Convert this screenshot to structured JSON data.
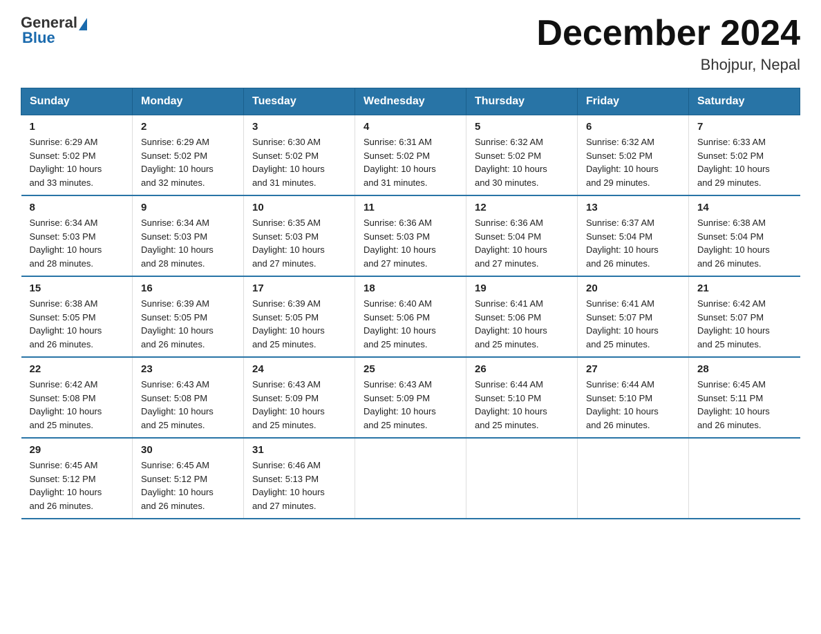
{
  "header": {
    "logo_general": "General",
    "logo_blue": "Blue",
    "month_title": "December 2024",
    "location": "Bhojpur, Nepal"
  },
  "days_of_week": [
    "Sunday",
    "Monday",
    "Tuesday",
    "Wednesday",
    "Thursday",
    "Friday",
    "Saturday"
  ],
  "weeks": [
    [
      {
        "day": "1",
        "sunrise": "6:29 AM",
        "sunset": "5:02 PM",
        "daylight": "10 hours and 33 minutes."
      },
      {
        "day": "2",
        "sunrise": "6:29 AM",
        "sunset": "5:02 PM",
        "daylight": "10 hours and 32 minutes."
      },
      {
        "day": "3",
        "sunrise": "6:30 AM",
        "sunset": "5:02 PM",
        "daylight": "10 hours and 31 minutes."
      },
      {
        "day": "4",
        "sunrise": "6:31 AM",
        "sunset": "5:02 PM",
        "daylight": "10 hours and 31 minutes."
      },
      {
        "day": "5",
        "sunrise": "6:32 AM",
        "sunset": "5:02 PM",
        "daylight": "10 hours and 30 minutes."
      },
      {
        "day": "6",
        "sunrise": "6:32 AM",
        "sunset": "5:02 PM",
        "daylight": "10 hours and 29 minutes."
      },
      {
        "day": "7",
        "sunrise": "6:33 AM",
        "sunset": "5:02 PM",
        "daylight": "10 hours and 29 minutes."
      }
    ],
    [
      {
        "day": "8",
        "sunrise": "6:34 AM",
        "sunset": "5:03 PM",
        "daylight": "10 hours and 28 minutes."
      },
      {
        "day": "9",
        "sunrise": "6:34 AM",
        "sunset": "5:03 PM",
        "daylight": "10 hours and 28 minutes."
      },
      {
        "day": "10",
        "sunrise": "6:35 AM",
        "sunset": "5:03 PM",
        "daylight": "10 hours and 27 minutes."
      },
      {
        "day": "11",
        "sunrise": "6:36 AM",
        "sunset": "5:03 PM",
        "daylight": "10 hours and 27 minutes."
      },
      {
        "day": "12",
        "sunrise": "6:36 AM",
        "sunset": "5:04 PM",
        "daylight": "10 hours and 27 minutes."
      },
      {
        "day": "13",
        "sunrise": "6:37 AM",
        "sunset": "5:04 PM",
        "daylight": "10 hours and 26 minutes."
      },
      {
        "day": "14",
        "sunrise": "6:38 AM",
        "sunset": "5:04 PM",
        "daylight": "10 hours and 26 minutes."
      }
    ],
    [
      {
        "day": "15",
        "sunrise": "6:38 AM",
        "sunset": "5:05 PM",
        "daylight": "10 hours and 26 minutes."
      },
      {
        "day": "16",
        "sunrise": "6:39 AM",
        "sunset": "5:05 PM",
        "daylight": "10 hours and 26 minutes."
      },
      {
        "day": "17",
        "sunrise": "6:39 AM",
        "sunset": "5:05 PM",
        "daylight": "10 hours and 25 minutes."
      },
      {
        "day": "18",
        "sunrise": "6:40 AM",
        "sunset": "5:06 PM",
        "daylight": "10 hours and 25 minutes."
      },
      {
        "day": "19",
        "sunrise": "6:41 AM",
        "sunset": "5:06 PM",
        "daylight": "10 hours and 25 minutes."
      },
      {
        "day": "20",
        "sunrise": "6:41 AM",
        "sunset": "5:07 PM",
        "daylight": "10 hours and 25 minutes."
      },
      {
        "day": "21",
        "sunrise": "6:42 AM",
        "sunset": "5:07 PM",
        "daylight": "10 hours and 25 minutes."
      }
    ],
    [
      {
        "day": "22",
        "sunrise": "6:42 AM",
        "sunset": "5:08 PM",
        "daylight": "10 hours and 25 minutes."
      },
      {
        "day": "23",
        "sunrise": "6:43 AM",
        "sunset": "5:08 PM",
        "daylight": "10 hours and 25 minutes."
      },
      {
        "day": "24",
        "sunrise": "6:43 AM",
        "sunset": "5:09 PM",
        "daylight": "10 hours and 25 minutes."
      },
      {
        "day": "25",
        "sunrise": "6:43 AM",
        "sunset": "5:09 PM",
        "daylight": "10 hours and 25 minutes."
      },
      {
        "day": "26",
        "sunrise": "6:44 AM",
        "sunset": "5:10 PM",
        "daylight": "10 hours and 25 minutes."
      },
      {
        "day": "27",
        "sunrise": "6:44 AM",
        "sunset": "5:10 PM",
        "daylight": "10 hours and 26 minutes."
      },
      {
        "day": "28",
        "sunrise": "6:45 AM",
        "sunset": "5:11 PM",
        "daylight": "10 hours and 26 minutes."
      }
    ],
    [
      {
        "day": "29",
        "sunrise": "6:45 AM",
        "sunset": "5:12 PM",
        "daylight": "10 hours and 26 minutes."
      },
      {
        "day": "30",
        "sunrise": "6:45 AM",
        "sunset": "5:12 PM",
        "daylight": "10 hours and 26 minutes."
      },
      {
        "day": "31",
        "sunrise": "6:46 AM",
        "sunset": "5:13 PM",
        "daylight": "10 hours and 27 minutes."
      },
      null,
      null,
      null,
      null
    ]
  ],
  "labels": {
    "sunrise": "Sunrise:",
    "sunset": "Sunset:",
    "daylight": "Daylight:"
  }
}
